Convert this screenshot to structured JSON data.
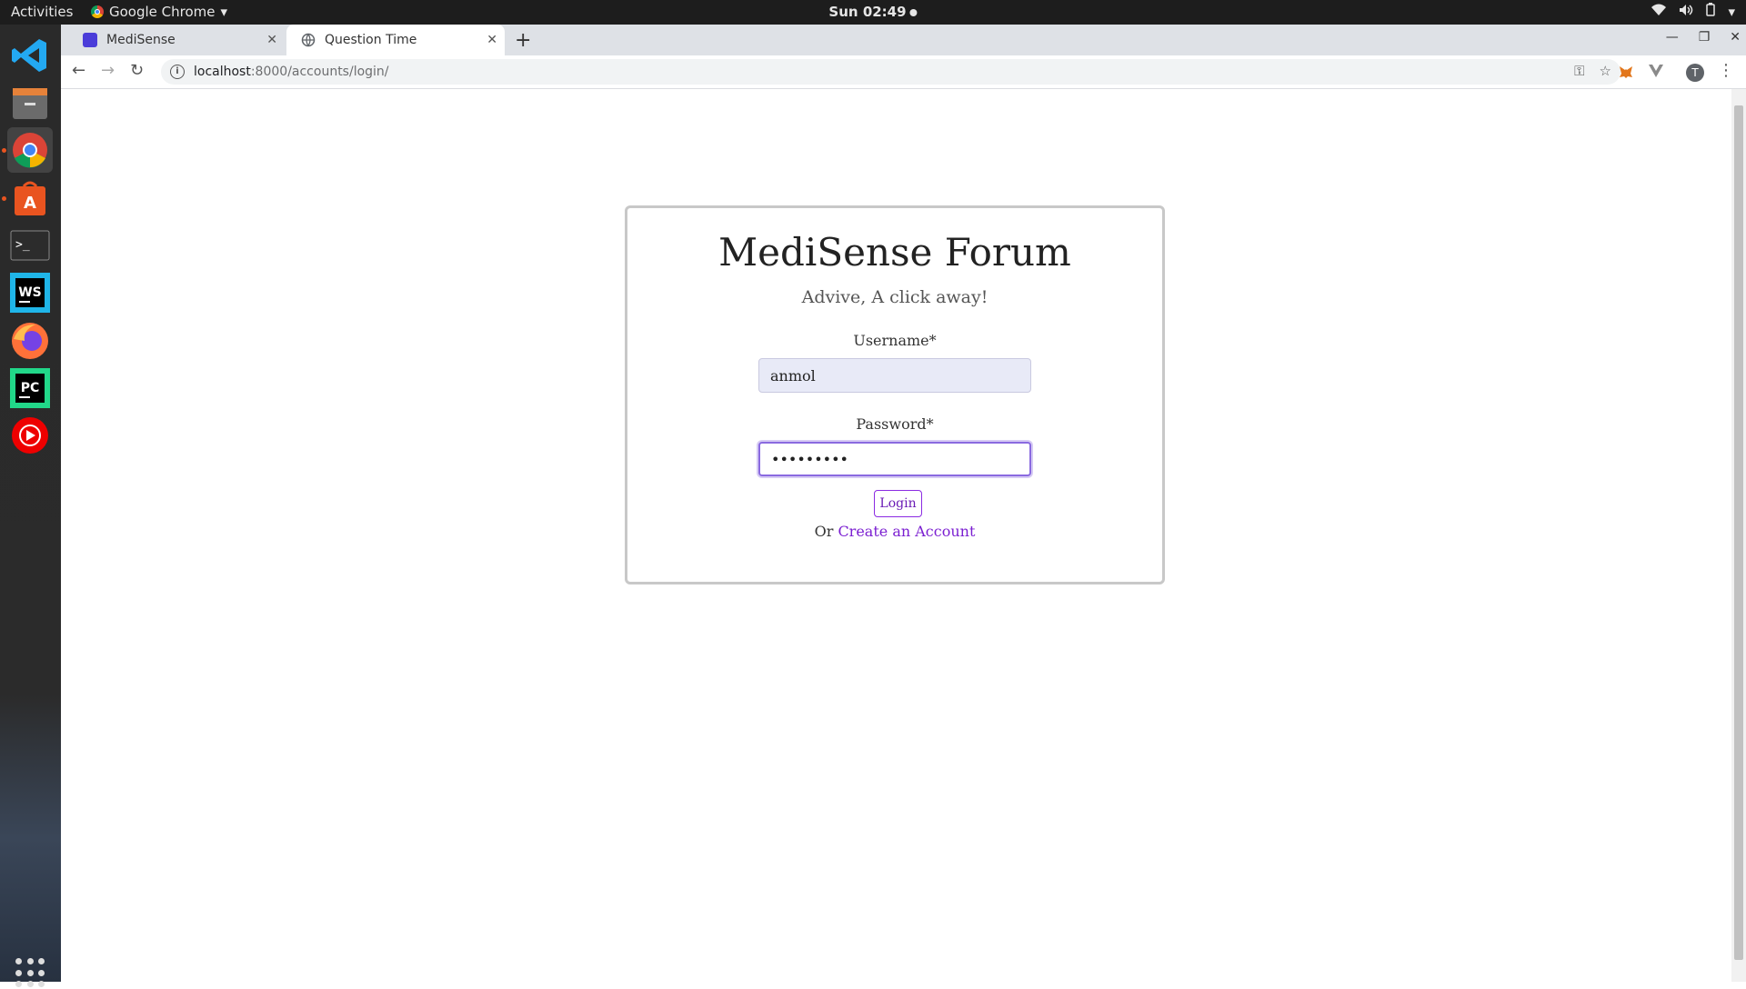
{
  "system_bar": {
    "activities": "Activities",
    "app_name": "Google Chrome",
    "clock": "Sun 02:49"
  },
  "dock": {
    "items": [
      "vscode",
      "files",
      "chrome",
      "software-center",
      "terminal",
      "webstorm",
      "firefox",
      "pycharm",
      "youtube-music"
    ]
  },
  "browser": {
    "tabs": [
      {
        "label": "MediSense",
        "active": false
      },
      {
        "label": "Question Time",
        "active": true
      }
    ],
    "url_host": "localhost",
    "url_path": ":8000/accounts/login/",
    "profile_initial": "T"
  },
  "page": {
    "title": "MediSense Forum",
    "tagline": "Advive, A click away!",
    "username_label": "Username*",
    "username_value": "anmol",
    "password_label": "Password*",
    "password_value": "•••••••••",
    "login_button": "Login",
    "or_text": "Or",
    "create_account_link": "Create an Account"
  },
  "colors": {
    "accent": "#7b1fd1",
    "input_bg": "#e8eaf7",
    "focus_border": "#8a6ae0"
  }
}
